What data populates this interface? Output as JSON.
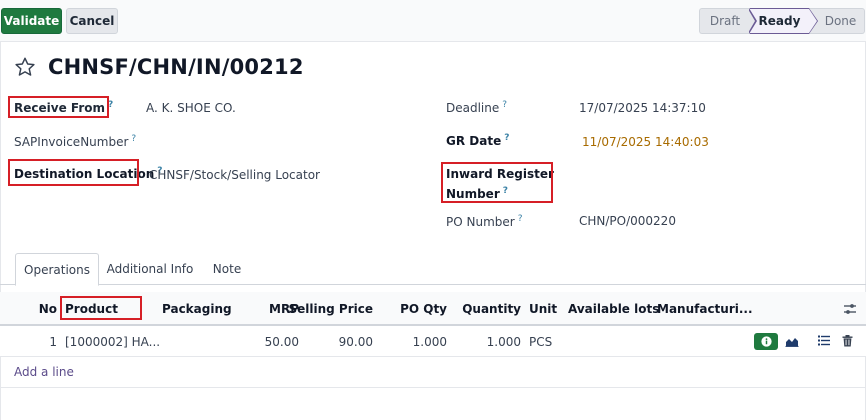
{
  "control_panel": {
    "validate_label": "Validate",
    "cancel_label": "Cancel",
    "stages": [
      "Draft",
      "Ready",
      "Done"
    ],
    "active_stage": "Ready"
  },
  "form": {
    "title": "CHNSF/CHN/IN/00212",
    "left": {
      "receive_from_label": "Receive From",
      "receive_from_value": "A. K. SHOE CO.",
      "sap_invoice_label": "SAPInvoiceNumber",
      "sap_invoice_value": "",
      "destination_label": "Destination Location",
      "destination_value": "CHNSF/Stock/Selling Locator"
    },
    "right": {
      "deadline_label": "Deadline",
      "deadline_value": "17/07/2025 14:37:10",
      "gr_date_label": "GR Date",
      "gr_date_value": "11/07/2025 14:40:03",
      "inward_register_label_line1": "Inward Register",
      "inward_register_label_line2": "Number",
      "inward_register_value": "",
      "po_number_label": "PO Number",
      "po_number_value": "CHN/PO/000220"
    },
    "help_marker": "?"
  },
  "tabs": [
    {
      "label": "Operations",
      "active": true
    },
    {
      "label": "Additional Info",
      "active": false
    },
    {
      "label": "Note",
      "active": false
    }
  ],
  "table": {
    "columns": [
      "No",
      "Product",
      "Packaging",
      "MRP",
      "Selling Price",
      "PO Qty",
      "Quantity",
      "Unit",
      "Available lots",
      "Manufacturi..."
    ],
    "rows": [
      {
        "no": "1",
        "product": "[1000002] HA...",
        "packaging": "",
        "mrp": "50.00",
        "selling_price": "90.00",
        "po_qty": "1.000",
        "quantity": "1.000",
        "unit": "PCS",
        "available_lots": "",
        "manufacturing": ""
      }
    ],
    "add_line_label": "Add a line"
  },
  "icons": {
    "star": "star-outline-icon",
    "column_settings": "sliders-icon",
    "row_info": "info-icon",
    "row_forecast": "area-chart-icon",
    "row_details": "list-icon",
    "row_delete": "trash-icon"
  },
  "colors": {
    "primary_green": "#1f7a3f",
    "accent_purple": "#6b5b95",
    "highlight_red": "#d61f26",
    "date_warning": "#a86b00"
  }
}
